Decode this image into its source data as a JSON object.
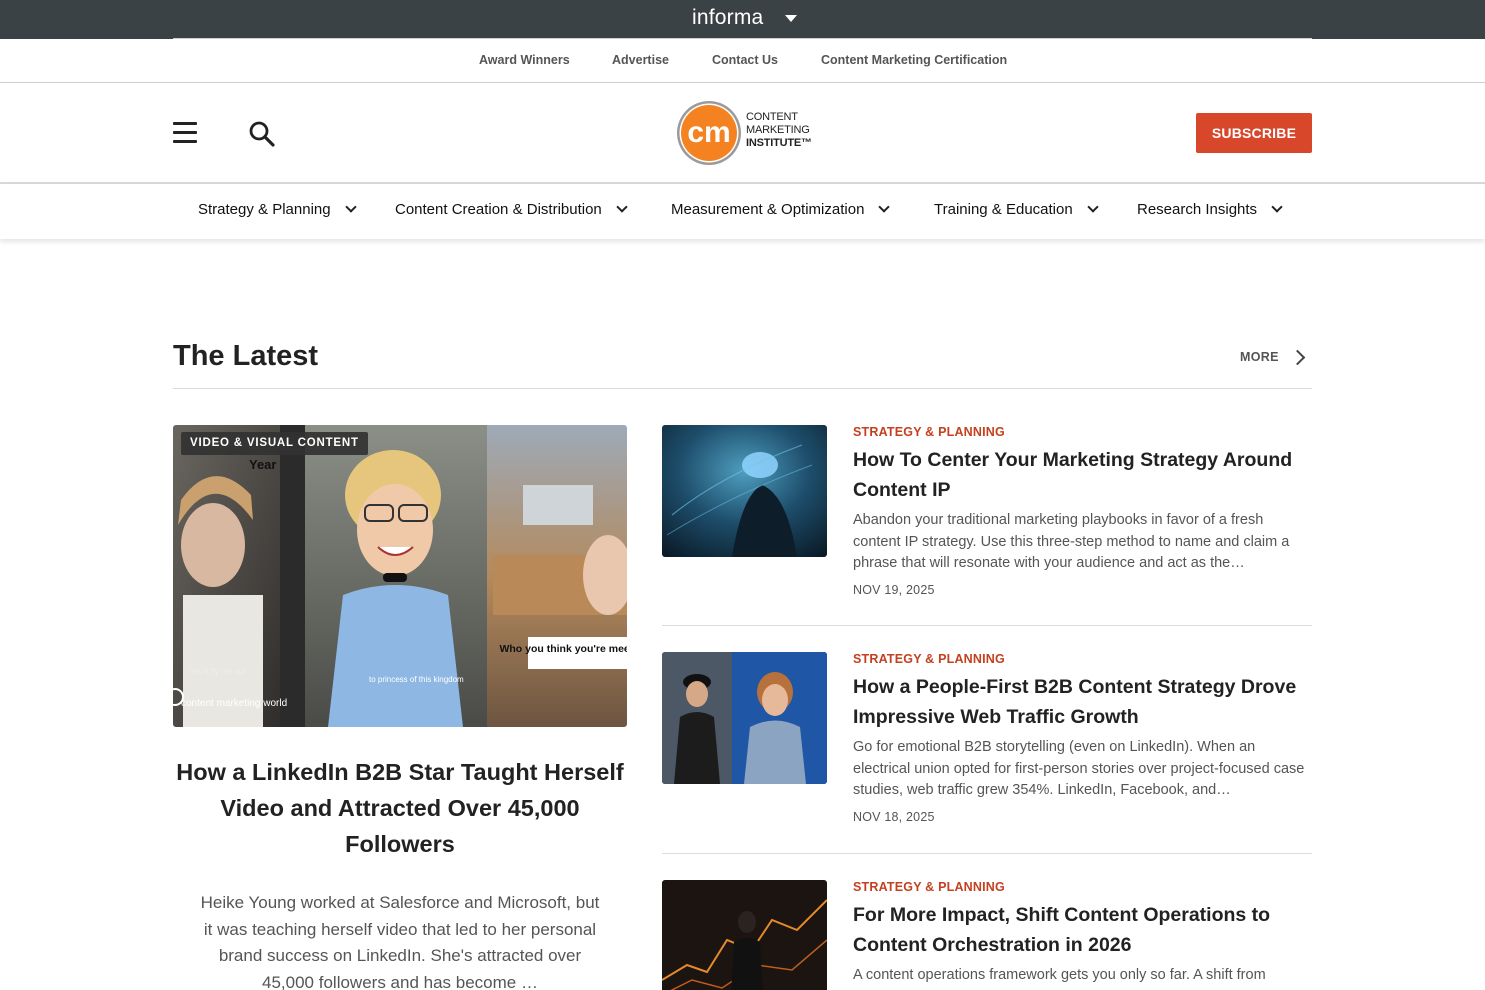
{
  "informa": {
    "brand": "informa",
    "menu_icon": "caret-down-icon"
  },
  "utility_links": [
    "Award Winners",
    "Advertise",
    "Contact Us",
    "Content Marketing Certification"
  ],
  "header": {
    "logo_mark": "cm",
    "logo_lines": [
      "CONTENT",
      "MARKETING",
      "INSTITUTE™"
    ],
    "subscribe_label": "SUBSCRIBE",
    "menu_icon": "hamburger-icon",
    "search_icon": "search-icon"
  },
  "nav": {
    "items": [
      {
        "label": "Strategy & Planning"
      },
      {
        "label": "Content Creation & Distribution"
      },
      {
        "label": "Measurement & Optimization"
      },
      {
        "label": "Training & Education"
      },
      {
        "label": "Research Insights"
      }
    ]
  },
  "latest": {
    "title": "The Latest",
    "more_label": "MORE"
  },
  "feature": {
    "badge": "VIDEO & VISUAL CONTENT",
    "title": "How a LinkedIn B2B Star Taught Herself Video and Attracted Over 45,000 Followers",
    "description": "Heike Young worked at Salesforce and Microsoft, but it was teaching herself video that led to her personal brand success on LinkedIn. She's attracted over 45,000 followers and has become …",
    "image_captions": [
      "Year",
      "You'll fly me out",
      "to princess of this kingdom",
      "Who you think you're meeting wit",
      "content marketing world"
    ]
  },
  "articles": [
    {
      "category": "STRATEGY & PLANNING",
      "title": "How To Center Your Marketing Strategy Around Content IP",
      "description": "Abandon your traditional marketing playbooks in favor of a fresh content IP strategy. Use this three-step method to name and claim a phrase that will resonate with your audience and act as the…",
      "date": "NOV 19, 2025"
    },
    {
      "category": "STRATEGY & PLANNING",
      "title": "How a People-First B2B Content Strategy Drove Impressive Web Traffic Growth",
      "description": "Go for emotional B2B storytelling (even on LinkedIn). When an electrical union opted for first-person stories over project-focused case studies, web traffic grew 354%. LinkedIn, Facebook, and…",
      "date": "NOV 18, 2025"
    },
    {
      "category": "STRATEGY & PLANNING",
      "title": "For More Impact, Shift Content Operations to Content Orchestration in 2026",
      "description": "A content operations framework gets you only so far. A shift from",
      "date": ""
    }
  ],
  "colors": {
    "accent": "#d9472b",
    "category": "#c4401f",
    "informa_bar": "#3b4246",
    "logo_orange": "#f58220"
  }
}
